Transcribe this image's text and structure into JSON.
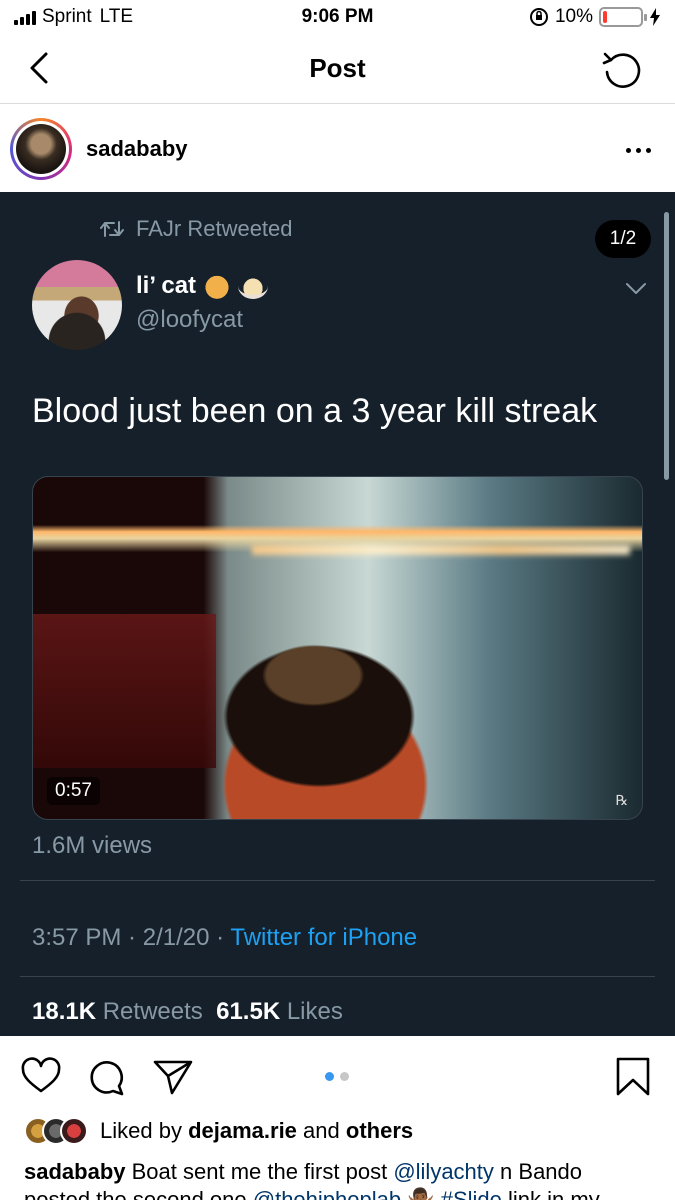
{
  "status_bar": {
    "carrier": "Sprint",
    "network": "LTE",
    "time": "9:06 PM",
    "battery_percent": "10%",
    "battery_level": 0.1,
    "battery_color": "#ff3b30"
  },
  "nav": {
    "title": "Post",
    "back_icon": "chevron-left-icon",
    "refresh_icon": "refresh-icon"
  },
  "post_header": {
    "username": "sadababy",
    "more_icon": "more-dots-icon"
  },
  "tweet": {
    "retweeted_by": "FAJr Retweeted",
    "page_indicator": "1/2",
    "display_name": "li’ cat",
    "handle": "@loofycat",
    "text": "Blood just been on a 3 year kill streak",
    "video_duration": "0:57",
    "views": "1.6M views",
    "time": "3:57 PM",
    "date": "2/1/20",
    "client": "Twitter for iPhone",
    "retweets_count": "18.1K",
    "retweets_label": "Retweets",
    "likes_count": "61.5K",
    "likes_label": "Likes",
    "colors": {
      "background": "#15202b",
      "muted": "#8899a6",
      "link": "#1da1f2"
    }
  },
  "actions": {
    "like_icon": "heart-icon",
    "comment_icon": "comment-icon",
    "share_icon": "send-icon",
    "save_icon": "bookmark-icon",
    "carousel_total": 2,
    "carousel_active": 1,
    "active_dot_color": "#3897f0"
  },
  "likes": {
    "prefix": "Liked by",
    "user": "dejama.rie",
    "middle": "and",
    "others": "others"
  },
  "caption": {
    "username": "sadababy",
    "text_1": "Boat sent me the first post",
    "mention_1": "@lilyachty",
    "text_2": "n Bando posted the second one",
    "mention_2": "@thehiphoplab",
    "emoji": "🤷🏾‍♂️",
    "hashtag": "#Slide",
    "text_3": "link in my"
  }
}
